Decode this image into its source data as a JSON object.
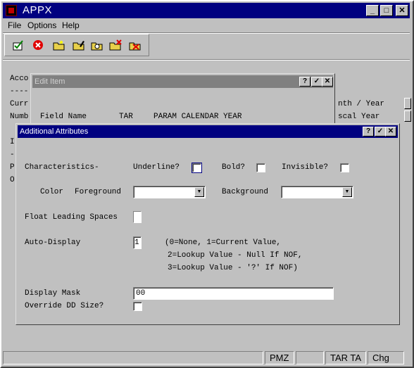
{
  "window": {
    "title": "APPX",
    "minimize": "_",
    "maximize": "□",
    "close": "✕"
  },
  "menu": [
    "File",
    "Options",
    "Help"
  ],
  "toolbar": [
    "check-icon",
    "stop-icon",
    "folder-add-icon",
    "folder-edit-icon",
    "folder-search-icon",
    "folder-delete-icon",
    "folder-cancel-icon"
  ],
  "background": {
    "lines": [
      "Acco",
      "----",
      "Curr",
      "Numb",
      "I",
      "-",
      "P",
      "O"
    ],
    "right_lines": [
      "nth / Year",
      "scal Year"
    ]
  },
  "edit_item": {
    "title": "Edit Item",
    "field_label": "Field Name",
    "field_value": "TAR",
    "field_desc": "PARAM CALENDAR YEAR",
    "buttons": [
      "?",
      "✓",
      "✕"
    ]
  },
  "dialog": {
    "title": "Additional Attributes",
    "buttons": [
      "?",
      "✓",
      "✕"
    ],
    "characteristics_label": "Characteristics-",
    "underline_label": "Underline?",
    "bold_label": "Bold?",
    "invisible_label": "Invisible?",
    "color_label": "Color",
    "foreground_label": "Foreground",
    "foreground_value": "",
    "background_label": "Background",
    "background_value": "",
    "float_label": "Float Leading Spaces",
    "auto_display_label": "Auto-Display",
    "auto_display_value": "1",
    "auto_help": [
      "(0=None, 1=Current Value,",
      "2=Lookup Value - Null If NOF,",
      "3=Lookup Value - '?' If NOF)"
    ],
    "display_mask_label": "Display Mask",
    "display_mask_value": "00",
    "override_label": "Override DD Size?"
  },
  "status": {
    "cells": [
      "",
      "PMZ",
      "",
      "TAR TA",
      "Chg"
    ]
  }
}
